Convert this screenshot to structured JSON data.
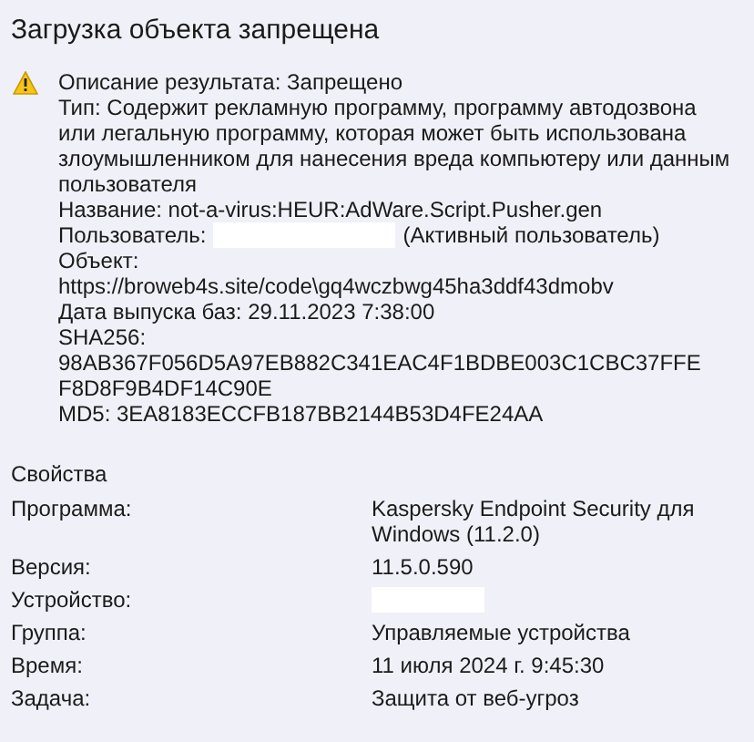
{
  "window": {
    "title": "Загрузка объекта запрещена"
  },
  "result": {
    "lines": [
      {
        "kind": "text",
        "text": "Описание результата: Запрещено"
      },
      {
        "kind": "text",
        "text": "Тип: Содержит рекламную программу, программу автодозвона или легальную программу, которая может быть использована злоумышленником для нанесения вреда компьютеру или данным пользователя"
      },
      {
        "kind": "text",
        "text": "Название: not-a-virus:HEUR:AdWare.Script.Pusher.gen"
      },
      {
        "kind": "redacted",
        "label": "Пользователь:",
        "suffix": "(Активный пользователь)"
      },
      {
        "kind": "text",
        "text": "Объект:"
      },
      {
        "kind": "text",
        "text": "https://broweb4s.site/code\\gq4wczbwg45ha3ddf43dmobv"
      },
      {
        "kind": "text",
        "text": "Дата выпуска баз: 29.11.2023 7:38:00"
      },
      {
        "kind": "text",
        "text": "SHA256:"
      },
      {
        "kind": "hash",
        "text": "98AB367F056D5A97EB882C341EAC4F1BDBE003C1CBC37FFEF8D8F9B4DF14C90E"
      },
      {
        "kind": "text",
        "text": "MD5: 3EA8183ECCFB187BB2144B53D4FE24AA"
      }
    ]
  },
  "properties": {
    "title": "Свойства",
    "rows": [
      {
        "label": "Программа:",
        "value": "Kaspersky Endpoint Security для Windows (11.2.0)"
      },
      {
        "label": "Версия:",
        "value": "11.5.0.590"
      },
      {
        "label": "Устройство:",
        "redacted": true
      },
      {
        "label": "Группа:",
        "value": "Управляемые устройства"
      },
      {
        "label": "Время:",
        "value": "11 июля 2024 г. 9:45:30"
      },
      {
        "label": "Задача:",
        "value": "Защита от веб-угроз"
      }
    ]
  }
}
